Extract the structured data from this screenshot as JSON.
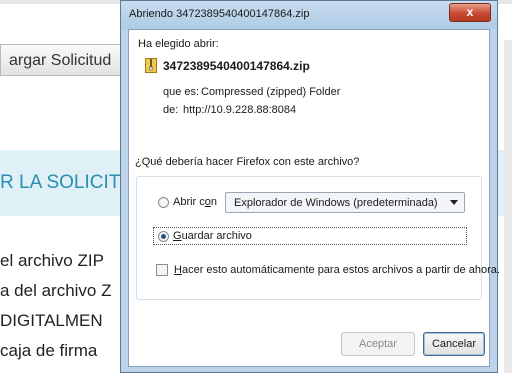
{
  "background_page": {
    "button_label": "argar Solicitud",
    "banner_text": "R LA SOLICIT",
    "lines": [
      "el archivo ZIP",
      "a del archivo Z",
      "DIGITALMEN",
      "caja de firma"
    ]
  },
  "dialog": {
    "title": "Abriendo 3472389540400147864.zip",
    "close_label": "x",
    "intro": "Ha elegido abrir:",
    "file_icon": "zip-folder-icon",
    "filename": "3472389540400147864.zip",
    "type_label": "que es:",
    "type_value": "Compressed (zipped) Folder",
    "from_label": "de:",
    "from_value": "http://10.9.228.88:8084",
    "question": "¿Qué debería hacer Firefox con este archivo?",
    "open_with": {
      "prefix": "Abrir c",
      "accel": "o",
      "suffix": "n",
      "selected_app": "Explorador de Windows (predeterminada)",
      "checked": false
    },
    "save": {
      "prefix": "",
      "accel": "G",
      "suffix": "uardar archivo",
      "checked": true
    },
    "auto": {
      "prefix": "",
      "accel": "H",
      "suffix": "acer esto automáticamente para estos archivos a partir de ahora.",
      "checked": false
    },
    "buttons": {
      "accept": "Aceptar",
      "cancel": "Cancelar"
    }
  }
}
